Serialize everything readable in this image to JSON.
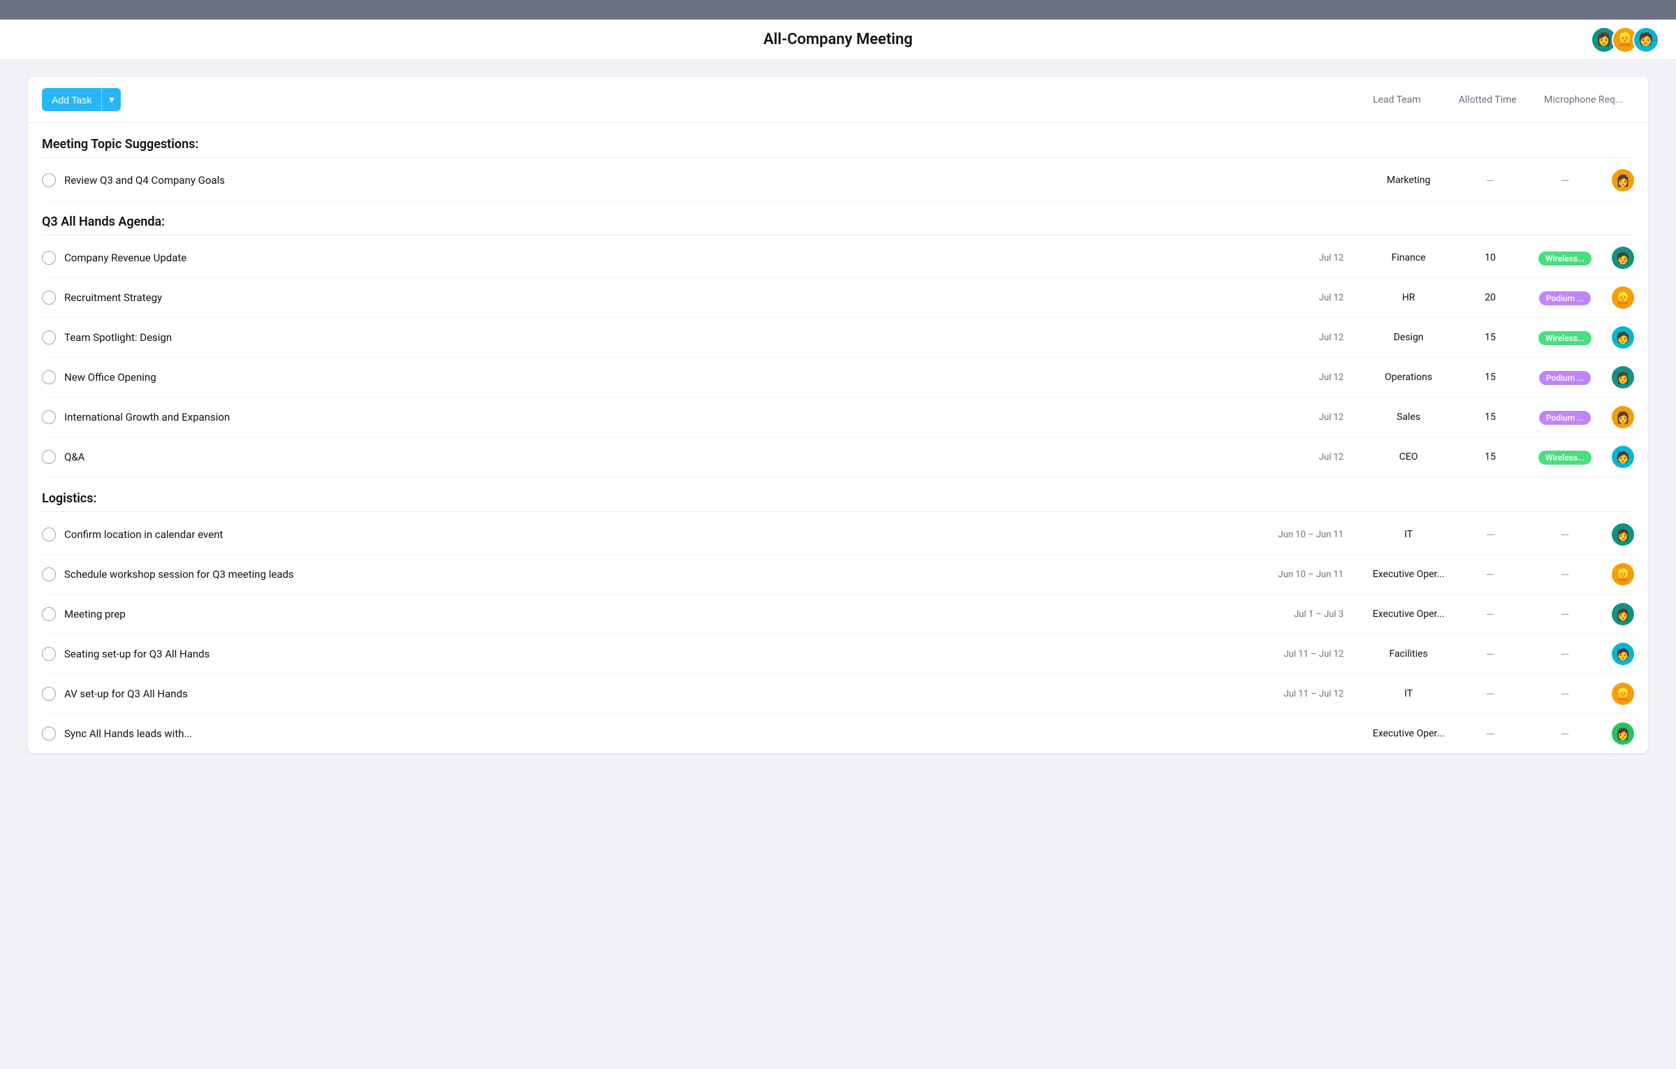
{
  "topBar": {},
  "header": {
    "title": "All-Company Meeting",
    "avatars": [
      {
        "emoji": "👩",
        "bg": "#0d9488"
      },
      {
        "emoji": "👱",
        "bg": "#f59e0b"
      },
      {
        "emoji": "🧑",
        "bg": "#06b6d4"
      }
    ]
  },
  "toolbar": {
    "addTaskLabel": "Add Task",
    "columns": [
      {
        "label": "Lead Team"
      },
      {
        "label": "Allotted Time"
      },
      {
        "label": "Microphone Req..."
      }
    ]
  },
  "sections": [
    {
      "title": "Meeting Topic Suggestions:",
      "tasks": [
        {
          "name": "Review Q3 and Q4 Company Goals",
          "date": "",
          "team": "Marketing",
          "time": "—",
          "mic": "—",
          "avatarEmoji": "👩",
          "avatarBg": "#f59e0b"
        }
      ]
    },
    {
      "title": "Q3 All Hands Agenda:",
      "tasks": [
        {
          "name": "Company Revenue Update",
          "date": "Jul 12",
          "team": "Finance",
          "time": "10",
          "mic": "Wireless...",
          "micType": "wireless",
          "avatarEmoji": "🧑",
          "avatarBg": "#0d9488"
        },
        {
          "name": "Recruitment Strategy",
          "date": "Jul 12",
          "team": "HR",
          "time": "20",
          "mic": "Podium ...",
          "micType": "podium",
          "avatarEmoji": "👱",
          "avatarBg": "#f59e0b"
        },
        {
          "name": "Team Spotlight: Design",
          "date": "Jul 12",
          "team": "Design",
          "time": "15",
          "mic": "Wireless...",
          "micType": "wireless",
          "avatarEmoji": "🧑",
          "avatarBg": "#06b6d4"
        },
        {
          "name": "New Office Opening",
          "date": "Jul 12",
          "team": "Operations",
          "time": "15",
          "mic": "Podium ...",
          "micType": "podium",
          "avatarEmoji": "👩",
          "avatarBg": "#0d9488"
        },
        {
          "name": "International Growth and Expansion",
          "date": "Jul 12",
          "team": "Sales",
          "time": "15",
          "mic": "Podium ...",
          "micType": "podium",
          "avatarEmoji": "👩",
          "avatarBg": "#f59e0b"
        },
        {
          "name": "Q&A",
          "date": "Jul 12",
          "team": "CEO",
          "time": "15",
          "mic": "Wireless...",
          "micType": "wireless",
          "avatarEmoji": "🧑",
          "avatarBg": "#06b6d4"
        }
      ]
    },
    {
      "title": "Logistics:",
      "tasks": [
        {
          "name": "Confirm location in calendar event",
          "date": "Jun 10 – Jun 11",
          "team": "IT",
          "time": "—",
          "mic": "—",
          "avatarEmoji": "👩",
          "avatarBg": "#0d9488"
        },
        {
          "name": "Schedule workshop session for Q3 meeting leads",
          "date": "Jun 10 – Jun 11",
          "team": "Executive Oper...",
          "time": "—",
          "mic": "—",
          "avatarEmoji": "👱",
          "avatarBg": "#f59e0b"
        },
        {
          "name": "Meeting prep",
          "date": "Jul 1 – Jul 3",
          "team": "Executive Oper...",
          "time": "—",
          "mic": "—",
          "avatarEmoji": "👩",
          "avatarBg": "#0d9488"
        },
        {
          "name": "Seating set-up for Q3 All Hands",
          "date": "Jul 11 – Jul 12",
          "team": "Facilities",
          "time": "—",
          "mic": "—",
          "avatarEmoji": "🧑",
          "avatarBg": "#06b6d4"
        },
        {
          "name": "AV set-up for Q3 All Hands",
          "date": "Jul 11 – Jul 12",
          "team": "IT",
          "time": "—",
          "mic": "—",
          "avatarEmoji": "👱",
          "avatarBg": "#f59e0b"
        },
        {
          "name": "Sync All Hands leads with...",
          "date": "",
          "team": "Executive Oper...",
          "time": "—",
          "mic": "—",
          "avatarEmoji": "👩",
          "avatarBg": "#22c55e"
        }
      ]
    }
  ]
}
